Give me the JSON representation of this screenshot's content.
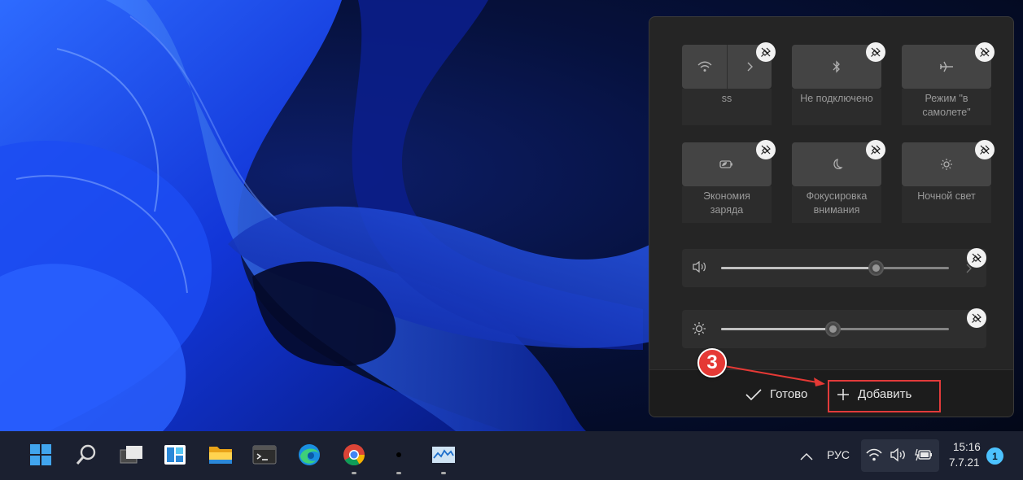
{
  "quick_settings": {
    "tiles": [
      {
        "id": "wifi",
        "label": "ss",
        "icon": "wifi-icon",
        "secondary_icon": "chevron-right-icon"
      },
      {
        "id": "bluetooth",
        "label": "Не подключено",
        "icon": "bluetooth-icon"
      },
      {
        "id": "airplane",
        "label": "Режим \"в самолете\"",
        "icon": "airplane-icon"
      },
      {
        "id": "battery_saver",
        "label": "Экономия заряда",
        "icon": "battery-saver-icon"
      },
      {
        "id": "focus_assist",
        "label": "Фокусировка внимания",
        "icon": "moon-icon"
      },
      {
        "id": "night_light",
        "label": "Ночной свет",
        "icon": "brightness-icon"
      }
    ],
    "volume": {
      "icon": "speaker-icon",
      "level": 0.68
    },
    "brightness": {
      "icon": "sun-icon",
      "level": 0.49
    },
    "footer": {
      "done_label": "Готово",
      "add_label": "Добавить"
    }
  },
  "annotation": {
    "step_number": "3",
    "color": "#e53935"
  },
  "taskbar": {
    "apps": [
      "start-icon",
      "search-icon",
      "task-view-icon",
      "widgets-icon",
      "file-explorer-icon",
      "terminal-icon",
      "edge-icon",
      "chrome-icon",
      "app-icon",
      "monitor-app-icon"
    ],
    "tray": {
      "language": "РУС",
      "time": "15:16",
      "date": "7.7.21",
      "notification_count": "1"
    }
  }
}
